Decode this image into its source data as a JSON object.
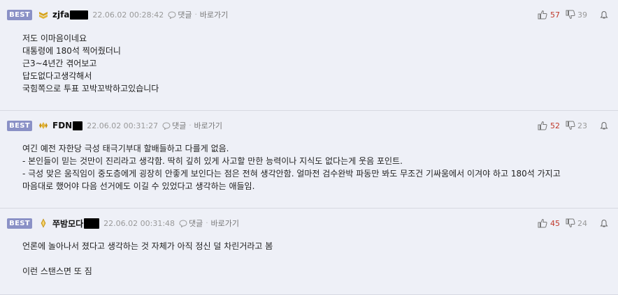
{
  "comments": [
    {
      "badge": "BEST",
      "level_icon": "gold-chevron-rank-icon",
      "nickname": "zjfa",
      "timestamp": "22.06.02 00:28:42",
      "reply_label": "댓글",
      "separator": "·",
      "goto_label": "바로가기",
      "upvotes": "57",
      "downvotes": "39",
      "lines": [
        "저도 이마음이네요",
        "대통령에 180석 찍어줬더니",
        "근3~4년간 겪어보고",
        "답도없다고생각해서",
        "국힘쪽으로 투표 꼬박꼬박하고있습니다"
      ]
    },
    {
      "badge": "BEST",
      "level_icon": "gold-wings-rank-icon",
      "nickname": "FDN",
      "timestamp": "22.06.02 00:31:27",
      "reply_label": "댓글",
      "separator": "·",
      "goto_label": "바로가기",
      "upvotes": "52",
      "downvotes": "23",
      "lines": [
        "여긴 예전 자한당 극성 태극기부대 할배들하고 다를게 없음.",
        "- 본인들이 믿는 것만이 진리라고 생각함. 딱히 깊히 있게 사고할 만한 능력이나 지식도 없다는게 웃음 포인트.",
        "- 극성 맞은 움직임이 중도층에게 굉장히 안좋게 보인다는 점은 전혀 생각안함. 얼마전 검수완박 파동만 봐도 무조건 기싸움에서 이겨야 하고 180석 가지고",
        "마음대로 했어야 다음 선거에도 이길 수 있었다고 생각하는 애들임."
      ]
    },
    {
      "badge": "BEST",
      "level_icon": "gold-gem-rank-icon",
      "nickname": "쭈밤모다",
      "timestamp": "22.06.02 00:31:48",
      "reply_label": "댓글",
      "separator": "·",
      "goto_label": "바로가기",
      "upvotes": "45",
      "downvotes": "24",
      "lines": [
        "언론에 놀아나서 졌다고 생각하는 것 자체가 아직 정신 덜 차린거라고 봄",
        "",
        "이런 스탠스면 또 짐"
      ]
    }
  ],
  "colors": {
    "background": "#eef0f7",
    "best_badge": "#8a91c6",
    "upvote_count": "#c0392b",
    "timestamp": "#999999"
  }
}
